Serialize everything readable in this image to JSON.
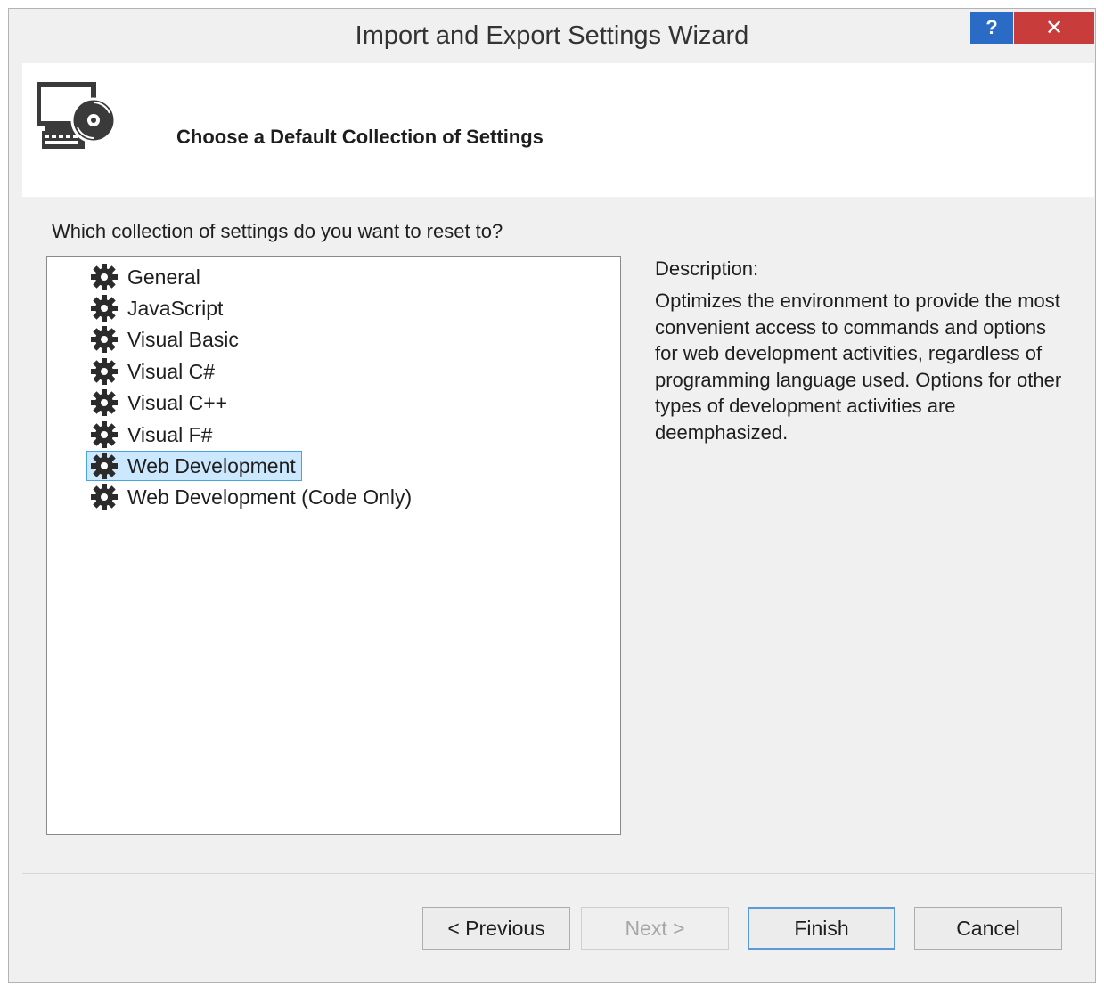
{
  "window": {
    "title": "Import and Export Settings Wizard",
    "help_label": "?",
    "close_label": "✕"
  },
  "header": {
    "icon": "computer-settings-disc-icon",
    "title": "Choose a Default Collection of Settings"
  },
  "main": {
    "question": "Which collection of settings do you want to reset to?",
    "items": [
      {
        "label": "General",
        "icon": "gear-icon",
        "selected": false
      },
      {
        "label": "JavaScript",
        "icon": "gear-icon",
        "selected": false
      },
      {
        "label": "Visual Basic",
        "icon": "gear-icon",
        "selected": false
      },
      {
        "label": "Visual C#",
        "icon": "gear-icon",
        "selected": false
      },
      {
        "label": "Visual C++",
        "icon": "gear-icon",
        "selected": false
      },
      {
        "label": "Visual F#",
        "icon": "gear-icon",
        "selected": false
      },
      {
        "label": "Web Development",
        "icon": "gear-icon",
        "selected": true
      },
      {
        "label": "Web Development (Code Only)",
        "icon": "gear-icon",
        "selected": false
      }
    ],
    "description_label": "Description:",
    "description_text": "Optimizes the environment to provide the most convenient access to commands and options for web development activities, regardless of programming language used. Options for other types of development activities are deemphasized."
  },
  "footer": {
    "previous_label": "< Previous",
    "next_label": "Next >",
    "finish_label": "Finish",
    "cancel_label": "Cancel"
  },
  "colors": {
    "close_button": "#c83c3c",
    "help_button": "#2a6bc5",
    "selection_bg": "#cce8ff",
    "selection_border": "#4aa3df"
  }
}
